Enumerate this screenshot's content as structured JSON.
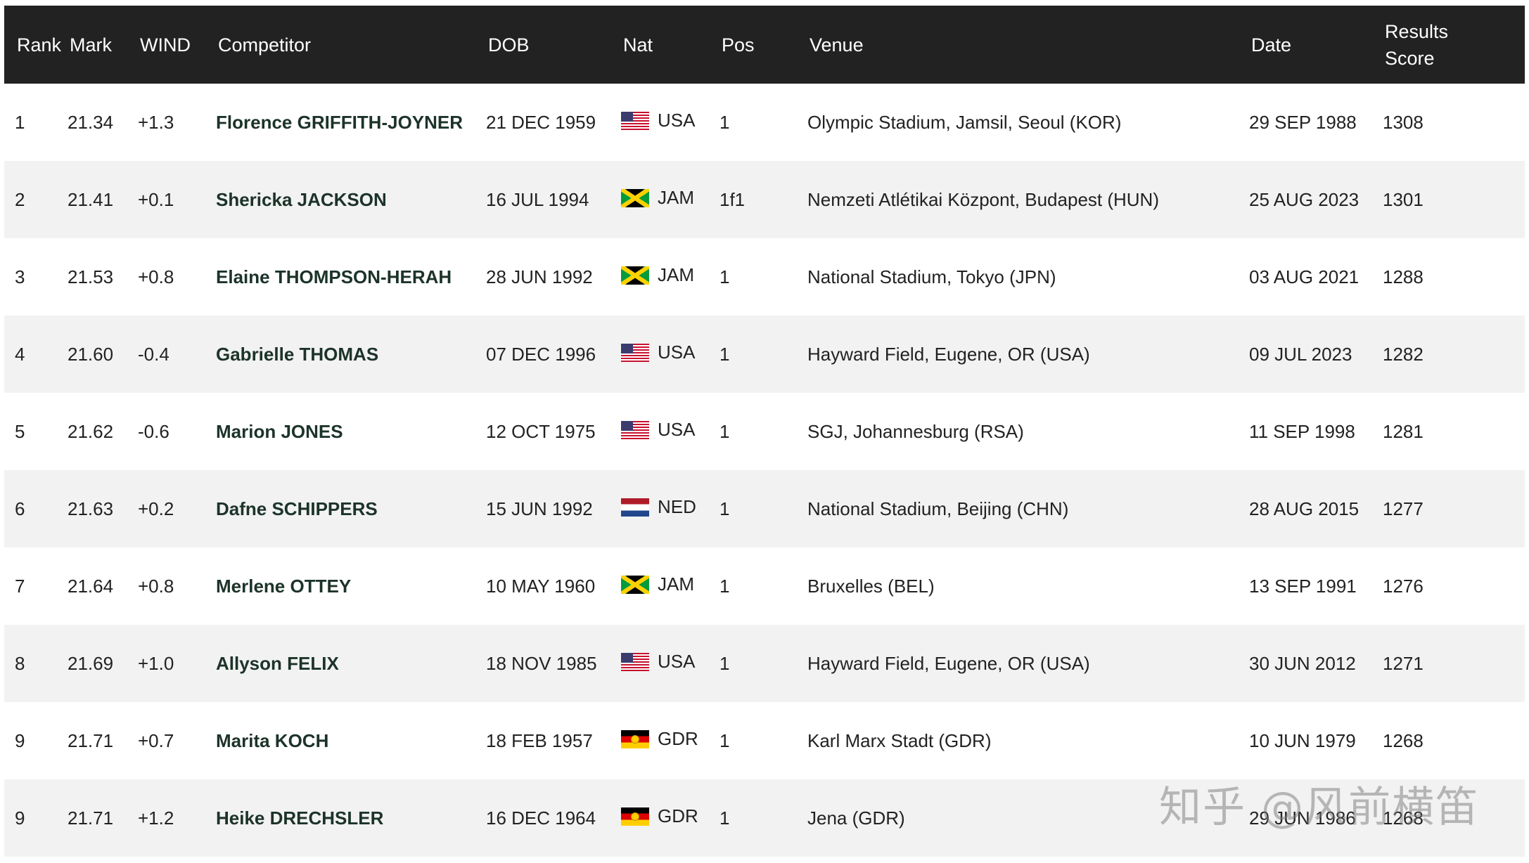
{
  "table": {
    "headers": {
      "rank": "Rank",
      "mark": "Mark",
      "wind": "WIND",
      "competitor": "Competitor",
      "dob": "DOB",
      "nat": "Nat",
      "pos": "Pos",
      "venue": "Venue",
      "date": "Date",
      "results_score_line1": "Results",
      "results_score_line2": "Score"
    },
    "rows": [
      {
        "rank": "1",
        "mark": "21.34",
        "wind": "+1.3",
        "competitor": "Florence GRIFFITH-JOYNER",
        "dob": "21 DEC 1959",
        "flag": "usa",
        "nat": "USA",
        "pos": "1",
        "venue": "Olympic Stadium, Jamsil, Seoul (KOR)",
        "date": "29 SEP 1988",
        "score": "1308"
      },
      {
        "rank": "2",
        "mark": "21.41",
        "wind": "+0.1",
        "competitor": "Shericka JACKSON",
        "dob": "16 JUL 1994",
        "flag": "jam",
        "nat": "JAM",
        "pos": "1f1",
        "venue": "Nemzeti Atlétikai Központ, Budapest (HUN)",
        "date": "25 AUG 2023",
        "score": "1301"
      },
      {
        "rank": "3",
        "mark": "21.53",
        "wind": "+0.8",
        "competitor": "Elaine THOMPSON-HERAH",
        "dob": "28 JUN 1992",
        "flag": "jam",
        "nat": "JAM",
        "pos": "1",
        "venue": "National Stadium, Tokyo (JPN)",
        "date": "03 AUG 2021",
        "score": "1288"
      },
      {
        "rank": "4",
        "mark": "21.60",
        "wind": "-0.4",
        "competitor": "Gabrielle THOMAS",
        "dob": "07 DEC 1996",
        "flag": "usa",
        "nat": "USA",
        "pos": "1",
        "venue": "Hayward Field, Eugene, OR (USA)",
        "date": "09 JUL 2023",
        "score": "1282"
      },
      {
        "rank": "5",
        "mark": "21.62",
        "wind": "-0.6",
        "competitor": "Marion JONES",
        "dob": "12 OCT 1975",
        "flag": "usa",
        "nat": "USA",
        "pos": "1",
        "venue": "SGJ, Johannesburg (RSA)",
        "date": "11 SEP 1998",
        "score": "1281"
      },
      {
        "rank": "6",
        "mark": "21.63",
        "wind": "+0.2",
        "competitor": "Dafne SCHIPPERS",
        "dob": "15 JUN 1992",
        "flag": "ned",
        "nat": "NED",
        "pos": "1",
        "venue": "National Stadium, Beijing (CHN)",
        "date": "28 AUG 2015",
        "score": "1277"
      },
      {
        "rank": "7",
        "mark": "21.64",
        "wind": "+0.8",
        "competitor": "Merlene OTTEY",
        "dob": "10 MAY 1960",
        "flag": "jam",
        "nat": "JAM",
        "pos": "1",
        "venue": "Bruxelles (BEL)",
        "date": "13 SEP 1991",
        "score": "1276"
      },
      {
        "rank": "8",
        "mark": "21.69",
        "wind": "+1.0",
        "competitor": "Allyson FELIX",
        "dob": "18 NOV 1985",
        "flag": "usa",
        "nat": "USA",
        "pos": "1",
        "venue": "Hayward Field, Eugene, OR (USA)",
        "date": "30 JUN 2012",
        "score": "1271"
      },
      {
        "rank": "9",
        "mark": "21.71",
        "wind": "+0.7",
        "competitor": "Marita KOCH",
        "dob": "18 FEB 1957",
        "flag": "gdr",
        "nat": "GDR",
        "pos": "1",
        "venue": "Karl Marx Stadt (GDR)",
        "date": "10 JUN 1979",
        "score": "1268"
      },
      {
        "rank": "9",
        "mark": "21.71",
        "wind": "+1.2",
        "competitor": "Heike DRECHSLER",
        "dob": "16 DEC 1964",
        "flag": "gdr",
        "nat": "GDR",
        "pos": "1",
        "venue": "Jena (GDR)",
        "date": "29 JUN 1986",
        "score": "1268"
      }
    ]
  },
  "watermark": "知乎 @风前横笛",
  "colors": {
    "header_bg": "#222222",
    "header_text": "#ffffff",
    "row_alt_bg": "#f2f2f2",
    "competitor_text": "#1c3329"
  }
}
